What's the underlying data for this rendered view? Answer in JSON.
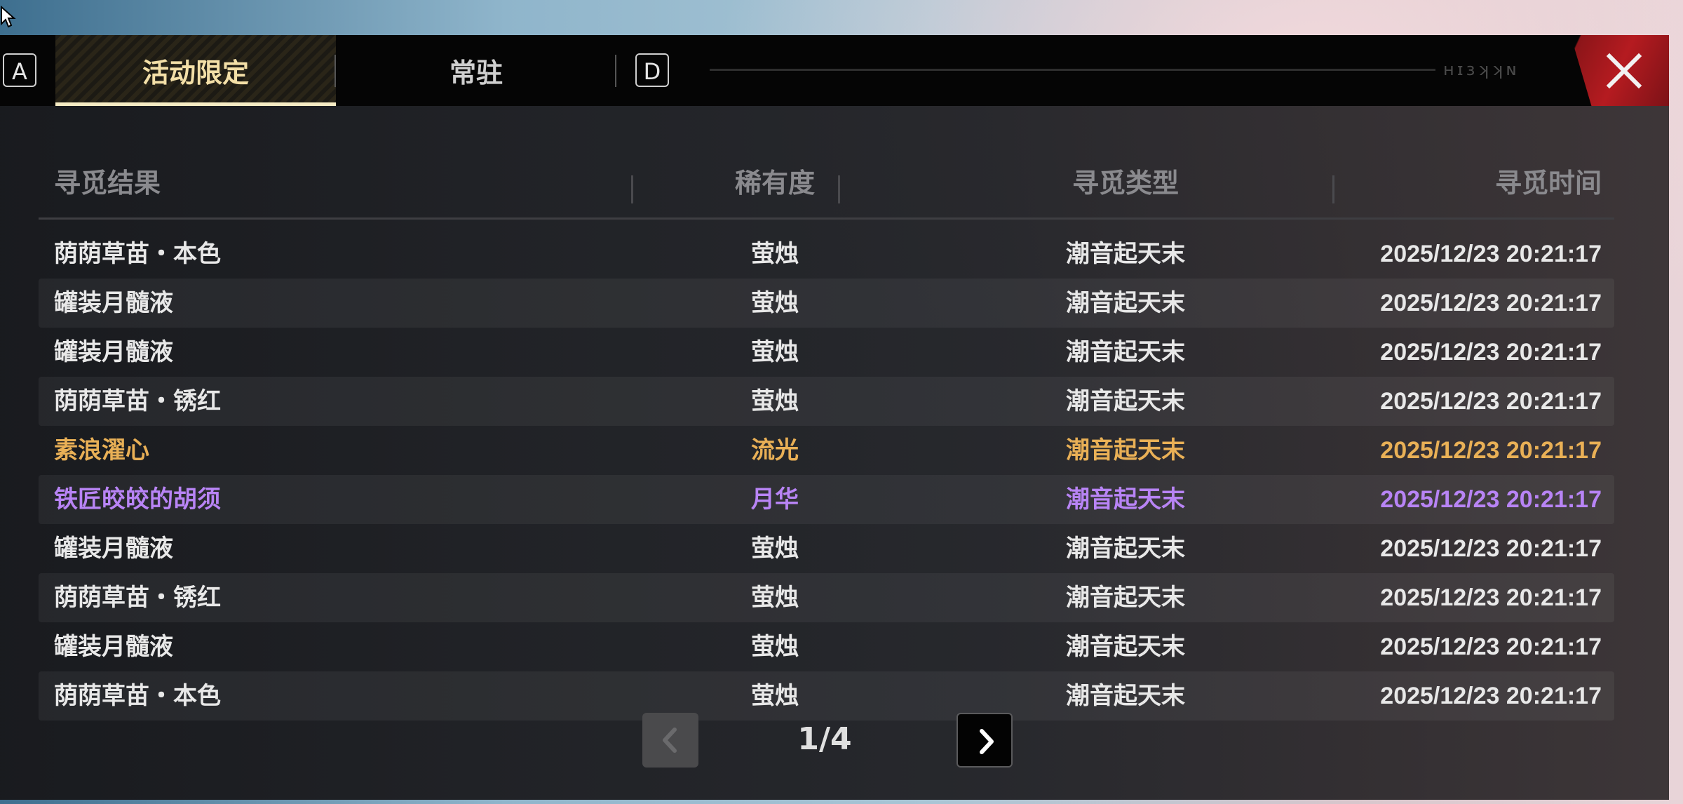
{
  "tabs": {
    "key_left": "A",
    "key_right": "D",
    "limited_label": "活动限定",
    "standard_label": "常驻",
    "track_marks": "ʜɪɜʞʞɴ"
  },
  "columns": {
    "result": "寻觅结果",
    "rarity": "稀有度",
    "type": "寻觅类型",
    "time": "寻觅时间"
  },
  "rows": [
    {
      "name": "荫荫草苗・本色",
      "rarity": "萤烛",
      "type": "潮音起天末",
      "time": "2025/12/23  20:21:17"
    },
    {
      "name": "罐装月髓液",
      "rarity": "萤烛",
      "type": "潮音起天末",
      "time": "2025/12/23  20:21:17"
    },
    {
      "name": "罐装月髓液",
      "rarity": "萤烛",
      "type": "潮音起天末",
      "time": "2025/12/23  20:21:17"
    },
    {
      "name": "荫荫草苗・锈红",
      "rarity": "萤烛",
      "type": "潮音起天末",
      "time": "2025/12/23  20:21:17"
    },
    {
      "name": "素浪濯心",
      "rarity": "流光",
      "type": "潮音起天末",
      "time": "2025/12/23  20:21:17"
    },
    {
      "name": "铁匠皎皎的胡须",
      "rarity": "月华",
      "type": "潮音起天末",
      "time": "2025/12/23  20:21:17"
    },
    {
      "name": "罐装月髓液",
      "rarity": "萤烛",
      "type": "潮音起天末",
      "time": "2025/12/23  20:21:17"
    },
    {
      "name": "荫荫草苗・锈红",
      "rarity": "萤烛",
      "type": "潮音起天末",
      "time": "2025/12/23  20:21:17"
    },
    {
      "name": "罐装月髓液",
      "rarity": "萤烛",
      "type": "潮音起天末",
      "time": "2025/12/23  20:21:17"
    },
    {
      "name": "荫荫草苗・本色",
      "rarity": "萤烛",
      "type": "潮音起天末",
      "time": "2025/12/23  20:21:17"
    }
  ],
  "rarity_colors": {
    "萤烛": "#e8e8e8",
    "流光": "#e9b056",
    "月华": "#b884f5"
  },
  "pagination": {
    "text": "1/4",
    "prev_icon": "chevron-left-icon",
    "next_icon": "chevron-right-icon"
  },
  "colors": {
    "accent_gold": "#f3dfa7",
    "close_red": "#b51b20"
  }
}
